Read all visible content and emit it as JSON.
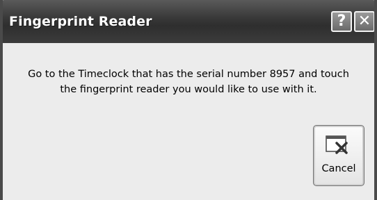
{
  "window": {
    "title": "Fingerprint Reader",
    "help_symbol": "?",
    "close_symbol": "✕"
  },
  "message": {
    "line1": "Go to the Timeclock that has the serial number 8957 and touch",
    "line2": "the fingerprint reader you would like to use with it."
  },
  "buttons": {
    "cancel": {
      "label": "Cancel",
      "icon": "window-cancel-icon"
    }
  }
}
